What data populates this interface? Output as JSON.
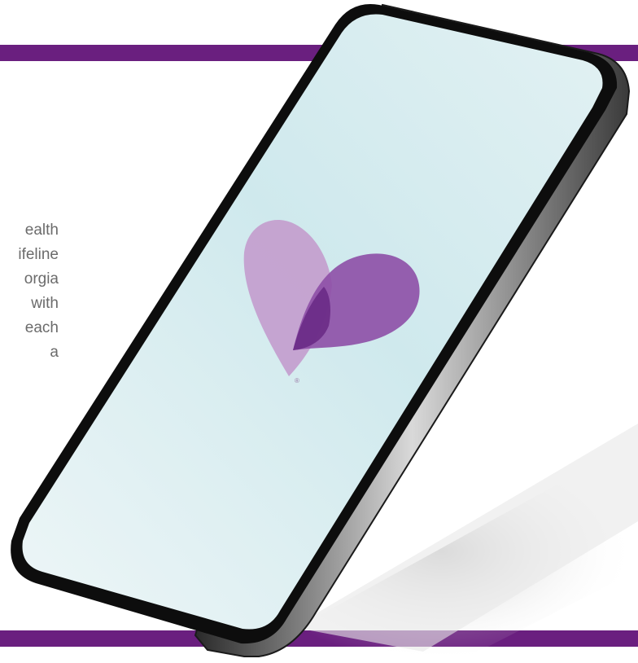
{
  "brand": {
    "accent_purple": "#6a1f7f",
    "heart_light": "#c4a0cf",
    "heart_dark": "#7b3a94",
    "screen_color": "#d3ecef"
  },
  "text_block": {
    "lines": [
      "ealth",
      "ifeline",
      "orgia",
      " with",
      "each",
      "a"
    ]
  },
  "phone": {
    "logo_icon": "heart-logo-icon",
    "registered_mark": "®"
  }
}
